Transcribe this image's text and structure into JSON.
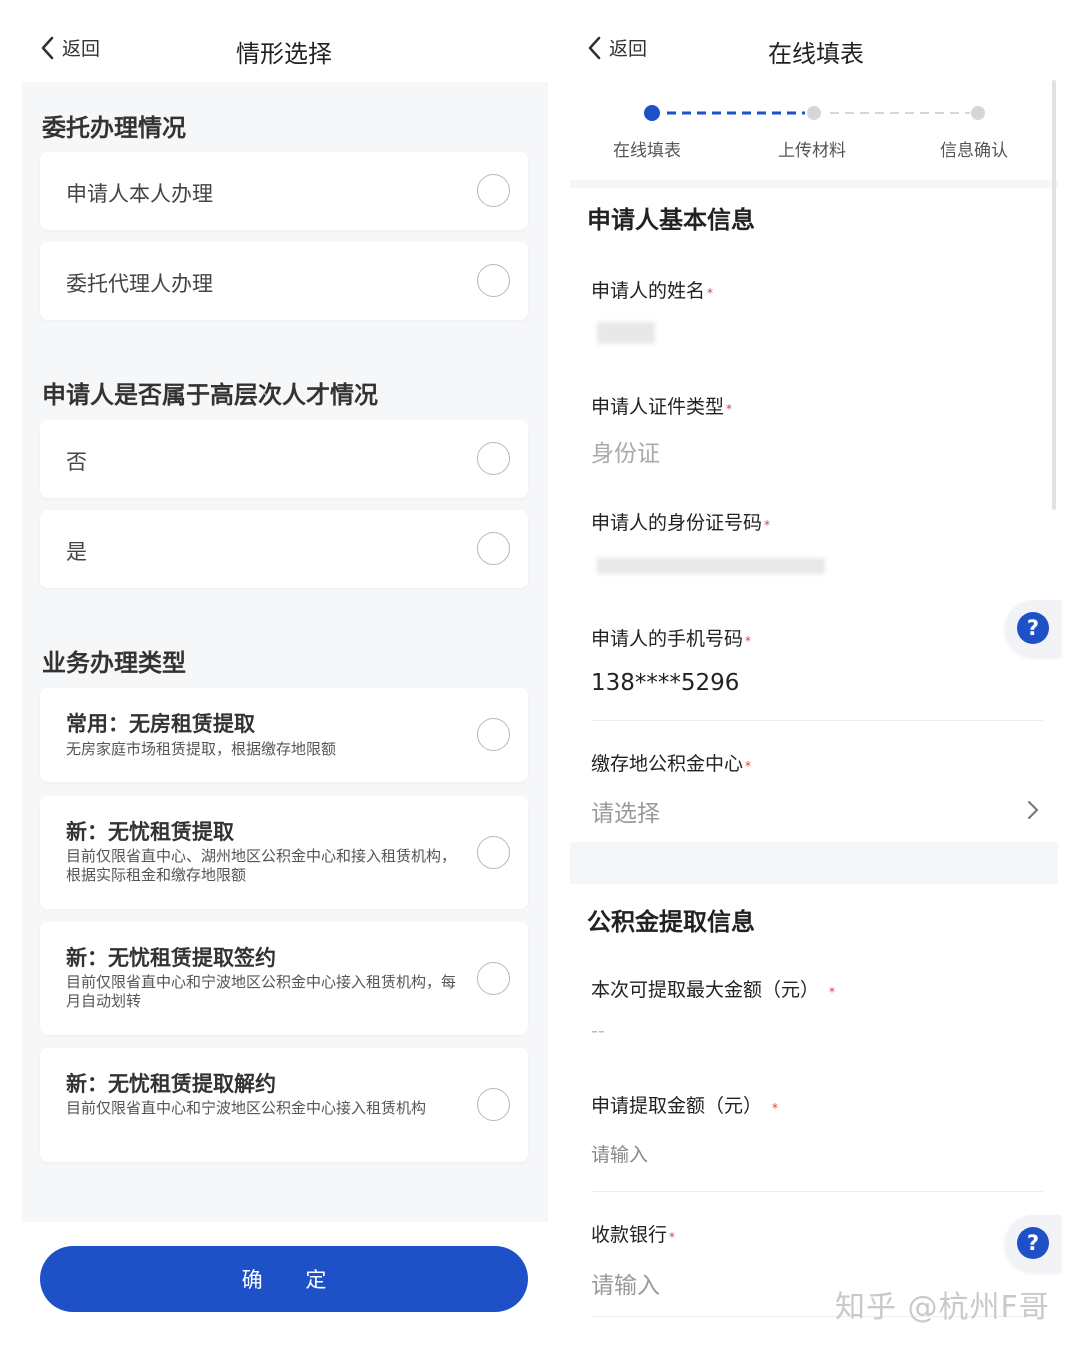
{
  "left": {
    "back_label": "返回",
    "title": "情形选择",
    "sections": [
      {
        "title": "委托办理情况",
        "options": [
          {
            "label": "申请人本人办理"
          },
          {
            "label": "委托代理人办理"
          }
        ]
      },
      {
        "title": "申请人是否属于高层次人才情况",
        "options": [
          {
            "label": "否"
          },
          {
            "label": "是"
          }
        ]
      },
      {
        "title": "业务办理类型",
        "options": [
          {
            "main": "常用：无房租赁提取",
            "sub": "无房家庭市场租赁提取，根据缴存地限额"
          },
          {
            "main": "新：无忧租赁提取",
            "sub": "目前仅限省直中心、湖州地区公积金中心和接入租赁机构，根据实际租金和缴存地限额"
          },
          {
            "main": "新：无忧租赁提取签约",
            "sub": "目前仅限省直中心和宁波地区公积金中心接入租赁机构，每月自动划转"
          },
          {
            "main": "新：无忧租赁提取解约",
            "sub": "目前仅限省直中心和宁波地区公积金中心接入租赁机构"
          }
        ]
      }
    ],
    "confirm_label": "确 定"
  },
  "right": {
    "back_label": "返回",
    "title": "在线填表",
    "steps": [
      {
        "label": "在线填表",
        "active": true
      },
      {
        "label": "上传材料",
        "active": false
      },
      {
        "label": "信息确认",
        "active": false
      }
    ],
    "basic_section_title": "申请人基本信息",
    "fields": {
      "name_label": "申请人的姓名",
      "id_type_label": "申请人证件类型",
      "id_type_value": "身份证",
      "id_number_label": "申请人的身份证号码",
      "phone_label": "申请人的手机号码",
      "phone_value": "138****5296",
      "center_label": "缴存地公积金中心",
      "center_placeholder": "请选择"
    },
    "withdraw_section_title": "公积金提取信息",
    "withdraw_fields": {
      "max_amount_label": "本次可提取最大金额（元）",
      "max_amount_value": "--",
      "apply_amount_label": "申请提取金额（元）",
      "apply_amount_placeholder": "请输入",
      "bank_label": "收款银行",
      "bank_placeholder": "请输入"
    },
    "required_mark": "*",
    "help_symbol": "?"
  },
  "watermark": "知乎 @杭州F哥",
  "colors": {
    "accent": "#1e50c8",
    "required": "#e03c3c",
    "panel_bg": "#f6f7f9"
  }
}
